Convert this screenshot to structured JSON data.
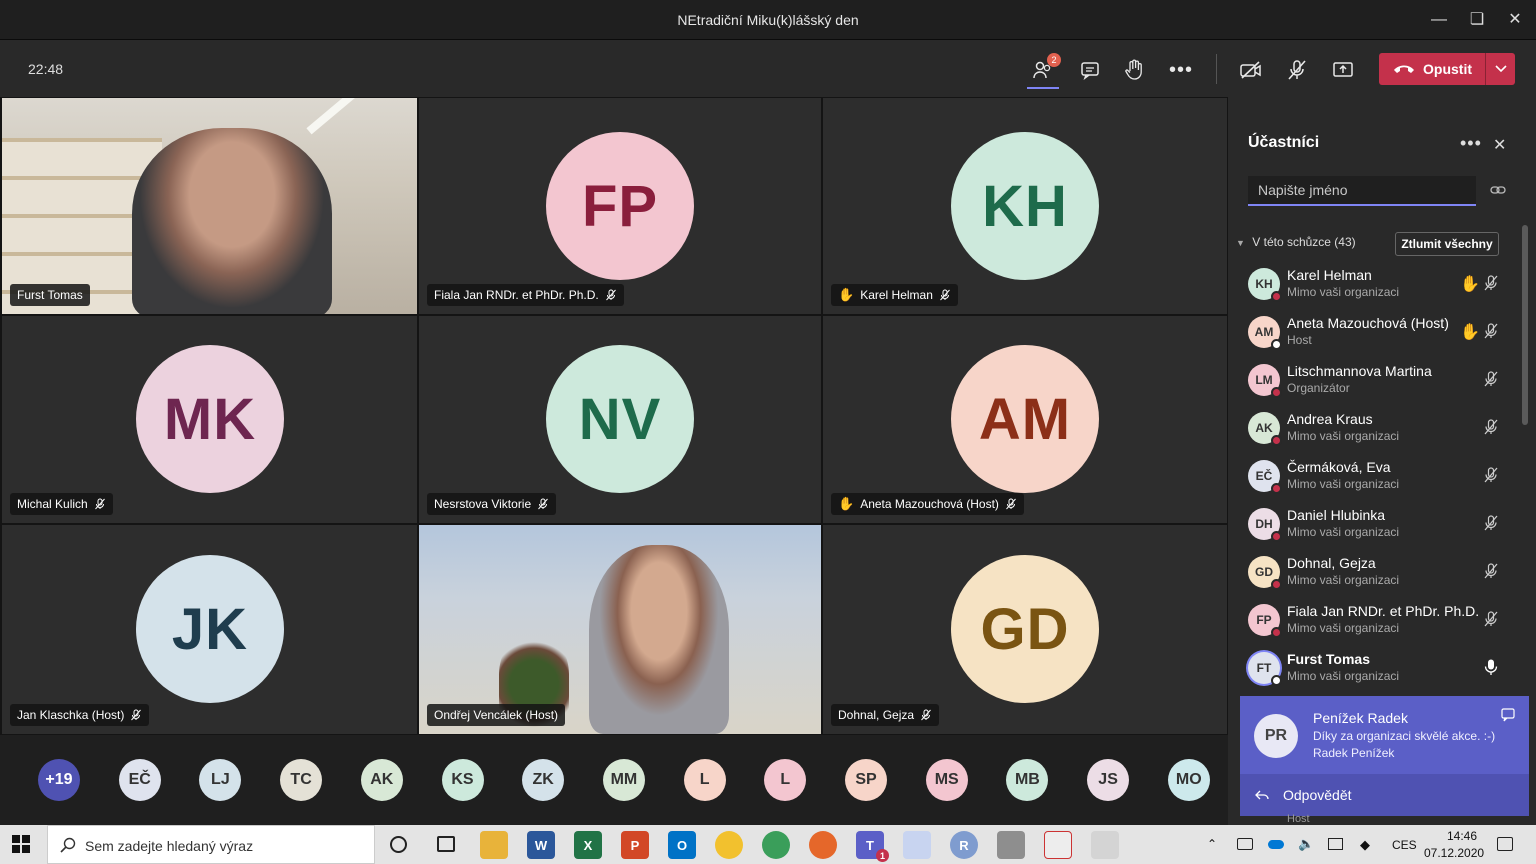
{
  "window": {
    "title": "NEtradiční Miku(k)lášský den"
  },
  "toolbar": {
    "clock": "22:48",
    "participants_badge": "2",
    "leave_label": "Opustit",
    "icons": [
      "participants-icon",
      "chat-icon",
      "raise-hand-icon",
      "more-icon",
      "camera-off-icon",
      "mic-off-icon",
      "share-screen-icon",
      "phone-icon",
      "chevron-down-icon"
    ]
  },
  "tiles": [
    {
      "name": "Furst Tomas",
      "type": "video"
    },
    {
      "name": "Fiala Jan RNDr. et PhDr. Ph.D.",
      "initials": "FP",
      "bg": "#f3c6d0",
      "fg": "#8a1e3c"
    },
    {
      "name": "Karel Helman",
      "initials": "KH",
      "bg": "#cde9dc",
      "fg": "#1e6b4b",
      "hand": true
    },
    {
      "name": "Michal Kulich",
      "initials": "MK",
      "bg": "#ecd2de",
      "fg": "#6e2650"
    },
    {
      "name": "Nesrstova Viktorie",
      "initials": "NV",
      "bg": "#cde9dc",
      "fg": "#1e6b4b"
    },
    {
      "name": "Aneta Mazouchová (Host)",
      "initials": "AM",
      "bg": "#f7d5c9",
      "fg": "#8c2f18",
      "hand": true
    },
    {
      "name": "Jan Klaschka (Host)",
      "initials": "JK",
      "bg": "#d4e2ea",
      "fg": "#1f3d4e"
    },
    {
      "name": "Ondřej Vencálek (Host)",
      "type": "video"
    },
    {
      "name": "Dohnal, Gejza",
      "initials": "GD",
      "bg": "#f6e3c4",
      "fg": "#7a5412"
    }
  ],
  "strip": [
    {
      "label": "+19",
      "bg": "#4f52b2",
      "fg": "#ffffff"
    },
    {
      "label": "EČ",
      "bg": "#dfe3ee",
      "fg": "#333"
    },
    {
      "label": "LJ",
      "bg": "#d4e2ea",
      "fg": "#333"
    },
    {
      "label": "TC",
      "bg": "#e4e1d6",
      "fg": "#333"
    },
    {
      "label": "AK",
      "bg": "#d8e8d6",
      "fg": "#333"
    },
    {
      "label": "KS",
      "bg": "#cde9dc",
      "fg": "#333"
    },
    {
      "label": "ZK",
      "bg": "#d4e2ea",
      "fg": "#333"
    },
    {
      "label": "MM",
      "bg": "#d8e8d6",
      "fg": "#333"
    },
    {
      "label": "L",
      "bg": "#f7d5c9",
      "fg": "#333"
    },
    {
      "label": "L",
      "bg": "#f3c6d0",
      "fg": "#333"
    },
    {
      "label": "SP",
      "bg": "#f7d5c9",
      "fg": "#333"
    },
    {
      "label": "MS",
      "bg": "#f3c6d0",
      "fg": "#333"
    },
    {
      "label": "MB",
      "bg": "#cde9dc",
      "fg": "#333"
    },
    {
      "label": "JS",
      "bg": "#ecdde6",
      "fg": "#333"
    },
    {
      "label": "MO",
      "bg": "#cde9ec",
      "fg": "#333"
    }
  ],
  "panel": {
    "title": "Účastníci",
    "search_placeholder": "Napište jméno",
    "section": "V této schůzce (43)",
    "mute_all": "Ztlumit všechny",
    "participants": [
      {
        "initials": "KH",
        "name": "Karel Helman",
        "sub": "Mimo vaši organizaci",
        "bg": "#cde9dc",
        "hand": true,
        "status": "#c4314b"
      },
      {
        "initials": "AM",
        "name": "Aneta Mazouchová (Host)",
        "sub": "Host",
        "bg": "#f7d5c9",
        "hand": true,
        "status": "#ffffff"
      },
      {
        "initials": "LM",
        "name": "Litschmannova Martina",
        "sub": "Organizátor",
        "bg": "#f3c6d0",
        "status": "#c4314b"
      },
      {
        "initials": "AK",
        "name": "Andrea Kraus",
        "sub": "Mimo vaši organizaci",
        "bg": "#d8e8d6",
        "status": "#c4314b"
      },
      {
        "initials": "EČ",
        "name": "Čermáková, Eva",
        "sub": "Mimo vaši organizaci",
        "bg": "#dfe3ee",
        "status": "#c4314b"
      },
      {
        "initials": "DH",
        "name": "Daniel Hlubinka",
        "sub": "Mimo vaši organizaci",
        "bg": "#ecdde6",
        "status": "#c4314b"
      },
      {
        "initials": "GD",
        "name": "Dohnal, Gejza",
        "sub": "Mimo vaši organizaci",
        "bg": "#f6e3c4",
        "status": "#c4314b"
      },
      {
        "initials": "FP",
        "name": "Fiala Jan RNDr. et PhDr. Ph.D.",
        "sub": "Mimo vaši organizaci",
        "bg": "#f3c6d0",
        "status": "#c4314b"
      },
      {
        "initials": "FT",
        "name": "Furst Tomas",
        "sub": "Mimo vaši organizaci",
        "bg": "#dfe3ee",
        "status": "#ffffff",
        "mic_on": true,
        "speaking": true
      }
    ]
  },
  "toast": {
    "initials": "PR",
    "name": "Penížek Radek",
    "message": "Díky za organizaci skvělé akce. :-)",
    "signature": "Radek Penížek",
    "reply": "Odpovědět",
    "peek": "Host"
  },
  "taskbar": {
    "search_placeholder": "Sem zadejte hledaný výraz",
    "lang": "CES",
    "time": "14:46",
    "date": "07.12.2020",
    "teams_badge": "1"
  },
  "colors": {
    "accent": "#5b5fc7",
    "leave": "#c4314b",
    "raise_hand": "#f3b93b"
  }
}
